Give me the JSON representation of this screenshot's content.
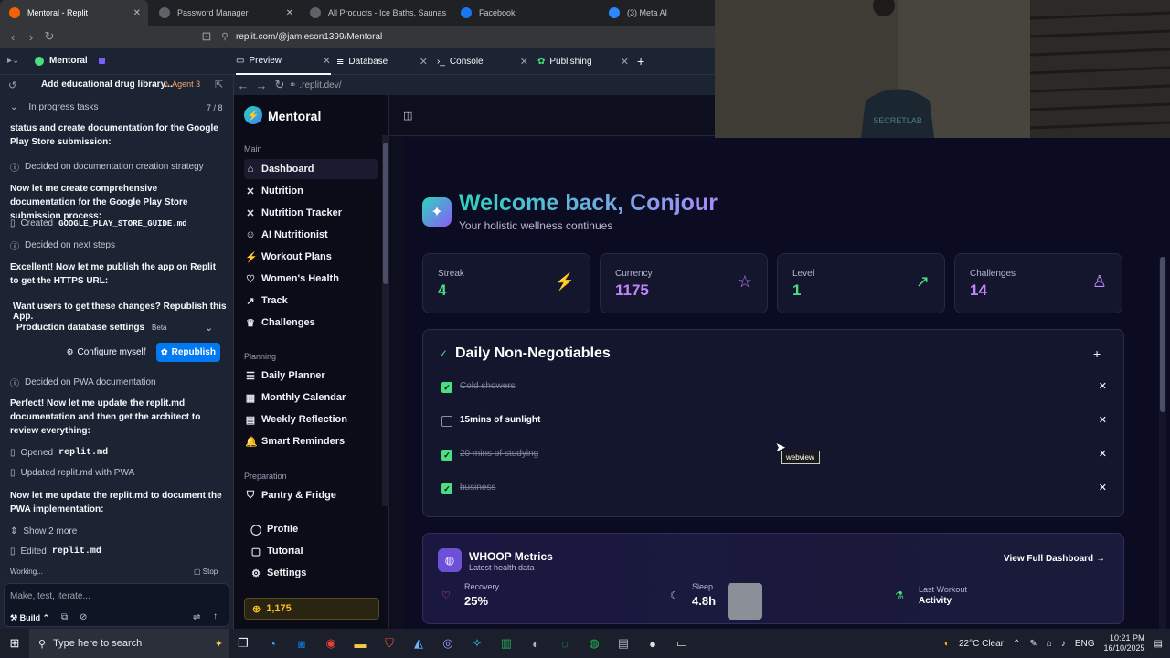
{
  "browser": {
    "tabs": [
      {
        "label": "Mentoral - Replit",
        "fav": "#f26207"
      },
      {
        "label": "Password Manager",
        "fav": "#5f6368"
      },
      {
        "label": "All Products - Ice Baths, Saunas & Re",
        "fav": "#5f6368"
      },
      {
        "label": "Facebook",
        "fav": "#1877f2"
      },
      {
        "label": "(3) Meta AI",
        "fav": "#2d88ff"
      }
    ],
    "url": "replit.com/@jamieson1399/Mentoral"
  },
  "workspace": {
    "project_name": "Mentoral",
    "tabs": [
      "Preview",
      "Database",
      "Console",
      "Publishing"
    ],
    "preview_url": ".replit.dev/"
  },
  "agent": {
    "title": "Add educational drug library...",
    "badge": "Agent 3",
    "tasks_label": "In progress tasks",
    "tasks_count": "7 / 8",
    "msg_status": "status and create documentation for the Google Play Store submission:",
    "decided_doc": "Decided on documentation creation strategy",
    "msg_create": "Now let me create comprehensive documentation for the Google Play Store submission process:",
    "created_label": "Created",
    "created_file": "GOOGLE_PLAY_STORE_GUIDE.md",
    "decided_next": "Decided on next steps",
    "msg_publish": "Excellent! Now let me publish the app on Replit to get the HTTPS URL:",
    "republish_prompt": "Want users to get these changes? Republish this App.",
    "db_settings": "Production database settings",
    "beta": "Beta",
    "configure": "Configure myself",
    "republish": "Republish",
    "decided_pwa": "Decided on PWA documentation",
    "msg_update": "Perfect! Now let me update the replit.md documentation and then get the architect to review everything:",
    "opened_label": "Opened",
    "opened_file": "replit.md",
    "updated_text": "Updated replit.md with PWA",
    "msg_now": "Now let me update the replit.md to document the PWA implementation:",
    "show_more": "Show 2 more",
    "edited_label": "Edited",
    "edited_file": "replit.md",
    "working": "Working...",
    "stop": "Stop",
    "input_placeholder": "Make, test, iterate...",
    "build": "Build"
  },
  "app": {
    "brand": "Mentoral",
    "sections": {
      "main": "Main",
      "planning": "Planning",
      "preparation": "Preparation"
    },
    "nav_main": [
      {
        "label": "Dashboard",
        "icon": "⌂"
      },
      {
        "label": "Nutrition",
        "icon": "✕"
      },
      {
        "label": "Nutrition Tracker",
        "icon": "✕"
      },
      {
        "label": "AI Nutritionist",
        "icon": "☺"
      },
      {
        "label": "Workout Plans",
        "icon": "⚡"
      },
      {
        "label": "Women's Health",
        "icon": "♡"
      },
      {
        "label": "Track",
        "icon": "↗"
      },
      {
        "label": "Challenges",
        "icon": "♛"
      }
    ],
    "nav_planning": [
      {
        "label": "Daily Planner",
        "icon": "☰"
      },
      {
        "label": "Monthly Calendar",
        "icon": "▦"
      },
      {
        "label": "Weekly Reflection",
        "icon": "▤"
      },
      {
        "label": "Smart Reminders",
        "icon": "🔔"
      }
    ],
    "nav_prep": [
      {
        "label": "Pantry & Fridge",
        "icon": "⛉"
      }
    ],
    "nav_bottom": [
      {
        "label": "Profile",
        "icon": "◯"
      },
      {
        "label": "Tutorial",
        "icon": "▢"
      },
      {
        "label": "Settings",
        "icon": "⚙"
      }
    ],
    "coins": "1,175",
    "welcome": "Welcome back, Conjour",
    "subtitle": "Your holistic wellness continues",
    "stats": [
      {
        "label": "Streak",
        "value": "4",
        "color": "#4ade80",
        "icon": "⚡"
      },
      {
        "label": "Currency",
        "value": "1175",
        "color": "#c084fc",
        "icon": "☆"
      },
      {
        "label": "Level",
        "value": "1",
        "color": "#4ade80",
        "icon": "↗"
      },
      {
        "label": "Challenges",
        "value": "14",
        "color": "#c084fc",
        "icon": "♙"
      }
    ],
    "non_neg_title": "Daily Non-Negotiables",
    "non_neg": [
      {
        "label": "Cold showers",
        "done": true
      },
      {
        "label": "15mins of sunlight",
        "done": false
      },
      {
        "label": "20 mins of studying",
        "done": true
      },
      {
        "label": "business",
        "done": true
      }
    ],
    "tooltip": "webview",
    "whoop": {
      "title": "WHOOP Metrics",
      "subtitle": "Latest health data",
      "view": "View Full Dashboard",
      "recovery_label": "Recovery",
      "recovery_value": "25%",
      "sleep_label": "Sleep",
      "sleep_value": "4.8h",
      "workout_label": "Last Workout",
      "workout_value": "Activity"
    }
  },
  "taskbar": {
    "search": "Type here to search",
    "weather": "22°C  Clear",
    "lang": "ENG",
    "time": "10:21 PM",
    "date": "16/10/2025"
  }
}
